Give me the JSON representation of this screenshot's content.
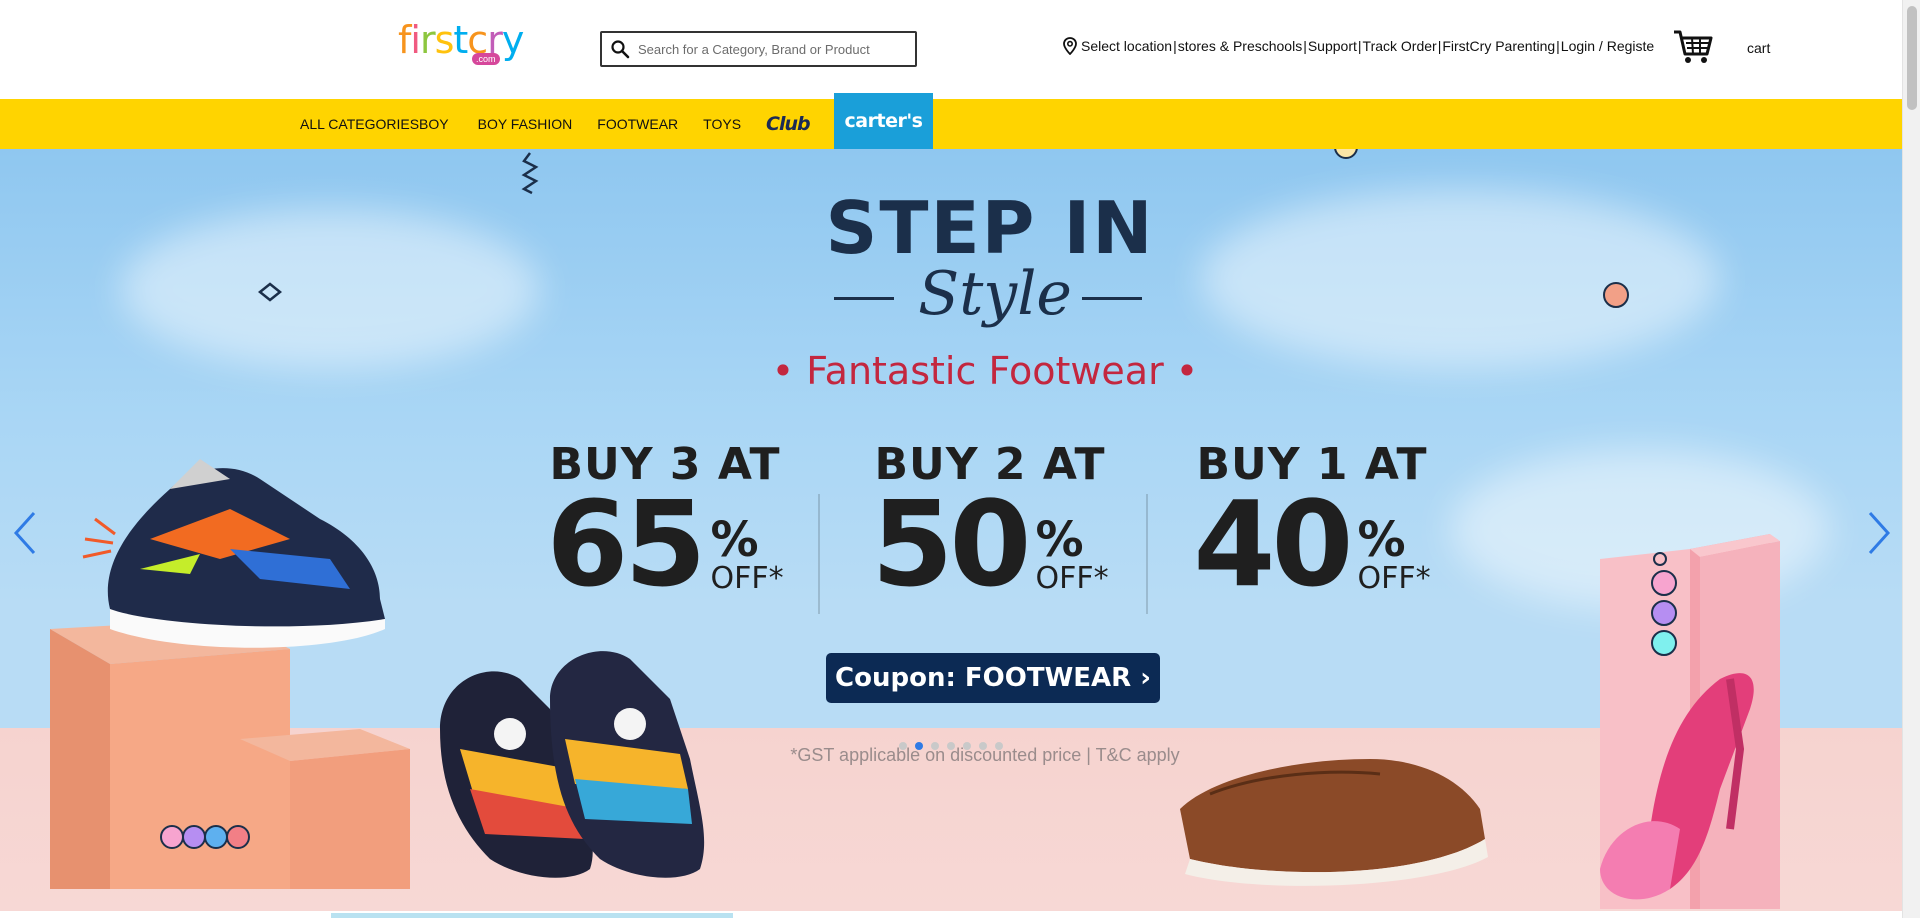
{
  "header": {
    "logo": {
      "brand": "firstcry",
      "suffix": ".com"
    },
    "search": {
      "placeholder": "Search for a Category, Brand or Product",
      "icon": "search-icon"
    },
    "links": [
      "Select location",
      "stores & Preschools",
      "Support",
      "Track Order",
      "FirstCry Parenting",
      "Login / Registe"
    ],
    "separator": "|",
    "cart_label": "cart"
  },
  "nav": {
    "items": [
      "ALL CATEGORIESBOY",
      "BOY FASHION",
      "FOOTWEAR",
      "TOYS"
    ],
    "club_label": "Club",
    "carters_label": "carter's"
  },
  "banner": {
    "headline": "STEP IN",
    "headline_script": "Style",
    "tagline": "• Fantastic Footwear •",
    "deals": [
      {
        "head": "BUY 3 AT",
        "num": "65",
        "pct": "%",
        "off": "OFF*"
      },
      {
        "head": "BUY 2 AT",
        "num": "50",
        "pct": "%",
        "off": "OFF*"
      },
      {
        "head": "BUY 1 AT",
        "num": "40",
        "pct": "%",
        "off": "OFF*"
      }
    ],
    "coupon": "Coupon: FOOTWEAR ›",
    "disclaimer": "*GST applicable on discounted price | T&C apply",
    "carousel": {
      "total_slides": 7,
      "active_slide": 2
    }
  },
  "colors": {
    "nav_bg": "#ffd400",
    "carters_bg": "#1a9fd9",
    "arrow": "#2f7be5",
    "tagline": "#c3273f",
    "coupon_bg": "#0c2a54"
  }
}
